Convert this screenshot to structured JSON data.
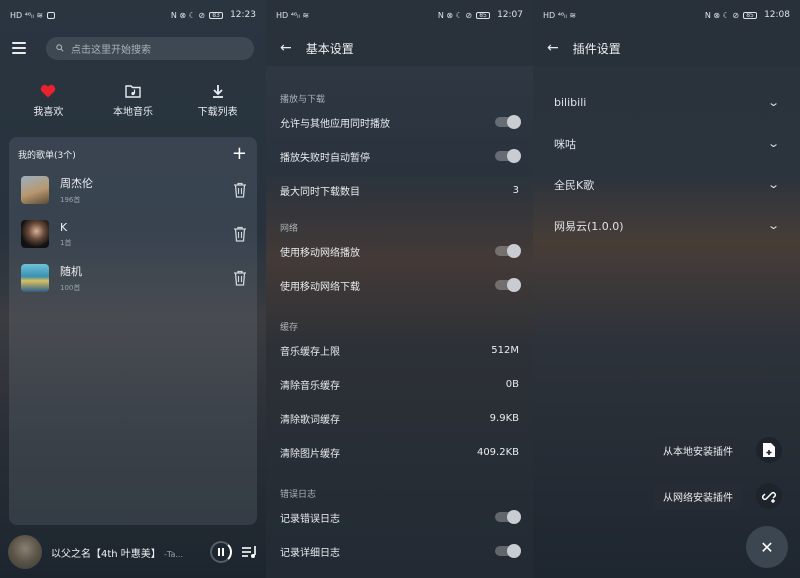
{
  "panel1": {
    "status": {
      "time": "12:23",
      "battery": "83"
    },
    "search_placeholder": "点击这里开始搜索",
    "quick": [
      {
        "label": "我喜欢",
        "icon": "heart-icon"
      },
      {
        "label": "本地音乐",
        "icon": "folder-music-icon"
      },
      {
        "label": "下载列表",
        "icon": "download-icon"
      }
    ],
    "songlists_title": "我的歌单(3个)",
    "songlists": [
      {
        "name": "周杰伦",
        "count": "196首"
      },
      {
        "name": "K",
        "count": "1首"
      },
      {
        "name": "随机",
        "count": "100首"
      }
    ],
    "player": {
      "title": "以父之名【4th 叶惠美】",
      "artist": "-Ta..."
    }
  },
  "panel2": {
    "status": {
      "time": "12:07",
      "battery": "85"
    },
    "title": "基本设置",
    "sections": [
      {
        "title": "播放与下载",
        "rows": [
          {
            "label": "允许与其他应用同时播放",
            "type": "toggle"
          },
          {
            "label": "播放失败时自动暂停",
            "type": "toggle"
          },
          {
            "label": "最大同时下载数目",
            "type": "value",
            "value": "3"
          }
        ]
      },
      {
        "title": "网络",
        "rows": [
          {
            "label": "使用移动网络播放",
            "type": "toggle"
          },
          {
            "label": "使用移动网络下载",
            "type": "toggle"
          }
        ]
      },
      {
        "title": "缓存",
        "rows": [
          {
            "label": "音乐缓存上限",
            "type": "value",
            "value": "512M"
          },
          {
            "label": "清除音乐缓存",
            "type": "value",
            "value": "0B"
          },
          {
            "label": "清除歌词缓存",
            "type": "value",
            "value": "9.9KB"
          },
          {
            "label": "清除图片缓存",
            "type": "value",
            "value": "409.2KB"
          }
        ]
      },
      {
        "title": "错误日志",
        "rows": [
          {
            "label": "记录错误日志",
            "type": "toggle"
          },
          {
            "label": "记录详细日志",
            "type": "toggle"
          }
        ]
      }
    ]
  },
  "panel3": {
    "status": {
      "time": "12:08",
      "battery": "85"
    },
    "title": "插件设置",
    "plugins": [
      "bilibili",
      "咪咕",
      "全民K歌",
      "网易云(1.0.0)"
    ],
    "fab_local": "从本地安装插件",
    "fab_network": "从网络安装插件"
  },
  "colors": {
    "heart": "#e8222e",
    "accent": "#e9ecef"
  }
}
